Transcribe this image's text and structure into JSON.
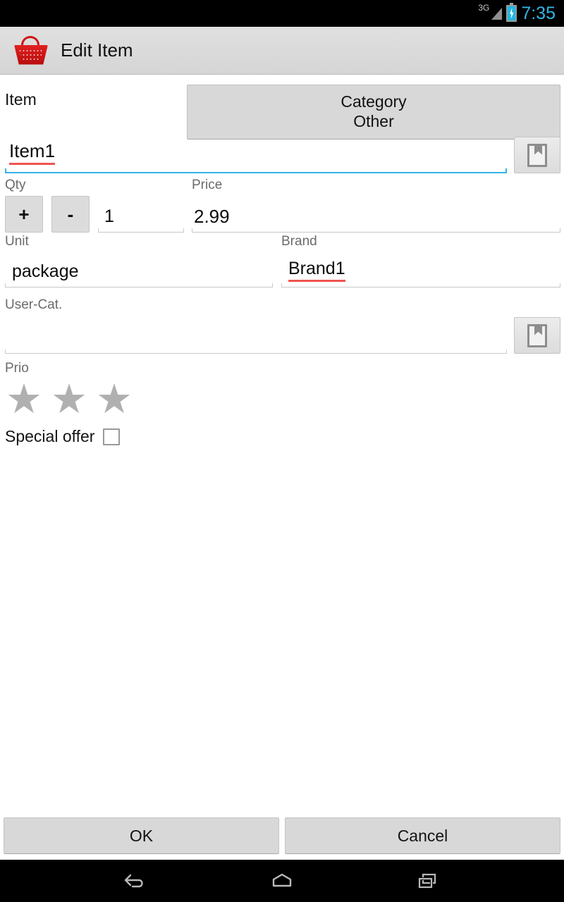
{
  "status_bar": {
    "network": "3G",
    "signal_icon": "signal-bars-icon",
    "battery_icon": "battery-charging-icon",
    "time": "7:35"
  },
  "app_bar": {
    "icon": "shopping-basket-icon",
    "title": "Edit Item"
  },
  "form": {
    "item_label": "Item",
    "category": {
      "title": "Category",
      "value": "Other"
    },
    "item_name": {
      "value": "Item1",
      "placeholder": ""
    },
    "item_bookmark_icon": "bookmark-icon",
    "qty": {
      "label": "Qty",
      "plus_label": "+",
      "minus_label": "-",
      "value": "1"
    },
    "price": {
      "label": "Price",
      "value": "2.99"
    },
    "unit": {
      "label": "Unit",
      "value": "package"
    },
    "brand": {
      "label": "Brand",
      "value": "Brand1"
    },
    "user_cat": {
      "label": "User-Cat.",
      "value": "",
      "placeholder": "",
      "bookmark_icon": "bookmark-icon"
    },
    "prio": {
      "label": "Prio",
      "stars": [
        "★",
        "★",
        "★"
      ],
      "filled_count": 0,
      "star_color": "#b0b0b0"
    },
    "special_offer": {
      "label": "Special offer",
      "checked": false
    }
  },
  "footer": {
    "ok_label": "OK",
    "cancel_label": "Cancel"
  },
  "nav_bar": {
    "back_icon": "back-arrow-icon",
    "home_icon": "home-icon",
    "recents_icon": "recent-apps-icon"
  },
  "colors": {
    "accent": "#33b5e5",
    "spellcheck": "#ef5350",
    "basket_red": "#cf1414",
    "button_gray": "#d8d8d8"
  }
}
